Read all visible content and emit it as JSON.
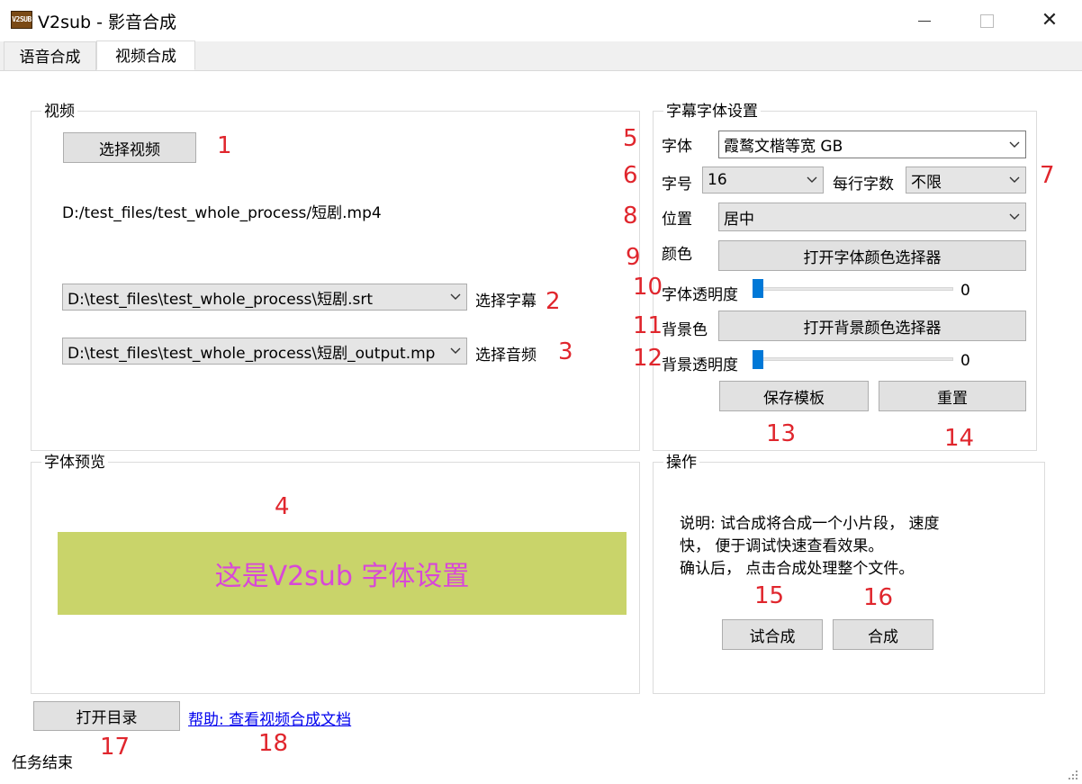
{
  "window": {
    "title": "V2sub - 影音合成",
    "icon_text": "V2SUB"
  },
  "tabs": [
    {
      "label": "语音合成"
    },
    {
      "label": "视频合成"
    }
  ],
  "video_group": {
    "title": "视频",
    "select_video_label": "选择视频",
    "video_path": "D:/test_files/test_whole_process/短剧.mp4",
    "subtitle_combo_value": "D:\\test_files\\test_whole_process\\短剧.srt",
    "select_subtitle_label": "选择字幕",
    "audio_combo_value": "D:\\test_files\\test_whole_process\\短剧_output.mp",
    "select_audio_label": "选择音频"
  },
  "font_settings": {
    "title": "字幕字体设置",
    "font_label": "字体",
    "font_value": "霞鹜文楷等宽 GB",
    "size_label": "字号",
    "size_value": "16",
    "chars_per_line_label": "每行字数",
    "chars_per_line_value": "不限",
    "position_label": "位置",
    "position_value": "居中",
    "color_label": "颜色",
    "color_button": "打开字体颜色选择器",
    "font_opacity_label": "字体透明度",
    "font_opacity_value": "0",
    "bg_color_label": "背景色",
    "bg_color_button": "打开背景颜色选择器",
    "bg_opacity_label": "背景透明度",
    "bg_opacity_value": "0",
    "save_template_label": "保存模板",
    "reset_label": "重置"
  },
  "preview": {
    "title": "字体预览",
    "sample_text": "这是V2sub 字体设置",
    "bg_color": "#c9d46a",
    "text_color": "#d848d8"
  },
  "operations": {
    "title": "操作",
    "description_lines": [
      "说明: 试合成将合成一个小片段， 速度",
      "快， 便于调试快速查看效果。",
      "确认后， 点击合成处理整个文件。"
    ],
    "trial_label": "试合成",
    "compose_label": "合成"
  },
  "footer": {
    "open_dir_label": "打开目录",
    "help_link": "帮助: 查看视频合成文档",
    "status": "任务结束"
  },
  "annotations": [
    "1",
    "2",
    "3",
    "4",
    "5",
    "6",
    "7",
    "8",
    "9",
    "10",
    "11",
    "12",
    "13",
    "14",
    "15",
    "16",
    "17",
    "18"
  ],
  "accent_color": "#0078d7",
  "annotation_color": "#e0262d"
}
